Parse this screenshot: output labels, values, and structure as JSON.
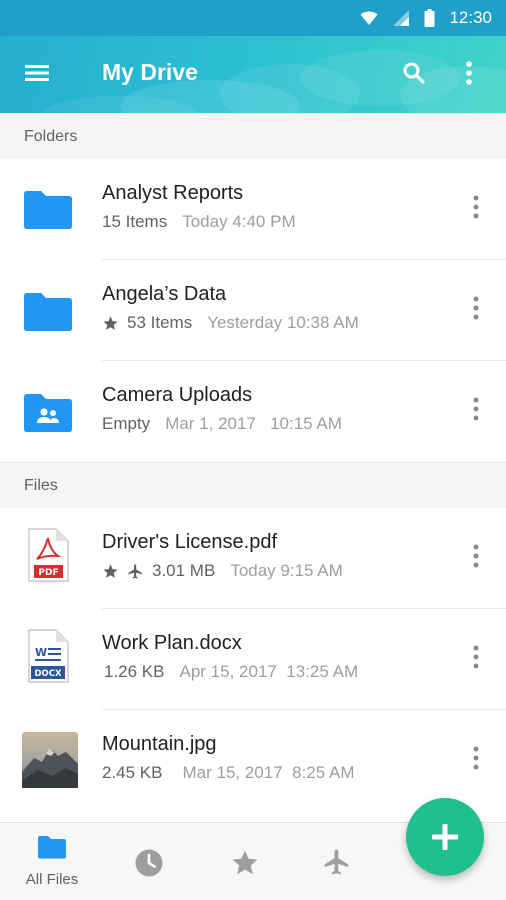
{
  "status_bar": {
    "time": "12:30"
  },
  "app_bar": {
    "title": "My Drive"
  },
  "sections": {
    "folders_label": "Folders",
    "files_label": "Files"
  },
  "folders": [
    {
      "name": "Analyst Reports",
      "meta": "15 Items",
      "date": "Today 4:40 PM",
      "starred": false,
      "icon": "folder-icon"
    },
    {
      "name": "Angela’s Data",
      "meta": "53 Items",
      "date": "Yesterday 10:38 AM",
      "starred": true,
      "icon": "folder-icon"
    },
    {
      "name": "Camera Uploads",
      "meta": "Empty",
      "date": "Mar 1, 2017   10:15 AM",
      "starred": false,
      "icon": "shared-folder-icon"
    }
  ],
  "files": [
    {
      "name": "Driver's License.pdf",
      "meta": "3.01 MB",
      "date": "Today 9:15 AM",
      "starred": true,
      "offline": true,
      "icon": "pdf-icon",
      "badge": "PDF"
    },
    {
      "name": "Work Plan.docx",
      "meta": "1.26 KB",
      "date": "Apr 15, 2017  13:25 AM",
      "starred": false,
      "offline": false,
      "icon": "docx-icon",
      "badge": "DOCX"
    },
    {
      "name": "Mountain.jpg",
      "meta": "2.45 KB",
      "date": "Mar 15, 2017  8:25 AM",
      "starred": false,
      "offline": false,
      "icon": "image-thumbnail"
    }
  ],
  "bottom_nav": {
    "items": [
      {
        "label": "All Files",
        "icon": "folder-icon",
        "active": true
      },
      {
        "label": "",
        "icon": "recent-clock-icon",
        "active": false
      },
      {
        "label": "",
        "icon": "star-icon",
        "active": false
      },
      {
        "label": "",
        "icon": "airplane-offline-icon",
        "active": false
      }
    ]
  },
  "colors": {
    "accent": "#2196f3",
    "fab": "#1fbf8f",
    "appbar_start": "#25aed0",
    "appbar_end": "#3fd3c9"
  }
}
